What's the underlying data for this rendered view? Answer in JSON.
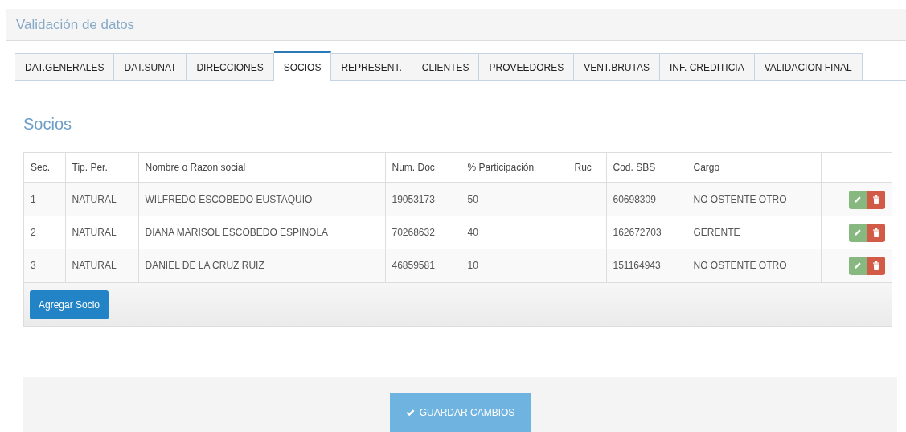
{
  "panel": {
    "title": "Validación de datos"
  },
  "tabs": [
    {
      "label": "DAT.GENERALES",
      "selected": false
    },
    {
      "label": "DAT.SUNAT",
      "selected": false
    },
    {
      "label": "DIRECCIONES",
      "selected": false
    },
    {
      "label": "SOCIOS",
      "selected": true
    },
    {
      "label": "REPRESENT.",
      "selected": false
    },
    {
      "label": "CLIENTES",
      "selected": false
    },
    {
      "label": "PROVEEDORES",
      "selected": false
    },
    {
      "label": "VENT.BRUTAS",
      "selected": false
    },
    {
      "label": "INF. CREDITICIA",
      "selected": false
    },
    {
      "label": "VALIDACION FINAL",
      "selected": false
    }
  ],
  "section": {
    "title": "Socios"
  },
  "table": {
    "columns": [
      "Sec.",
      "Tip. Per.",
      "Nombre o Razon social",
      "Num. Doc",
      "% Participación",
      "Ruc",
      "Cod. SBS",
      "Cargo"
    ],
    "rows": [
      [
        "1",
        "NATURAL",
        "WILFREDO ESCOBEDO EUSTAQUIO",
        "19053173",
        "50",
        "",
        "60698309",
        "NO OSTENTE OTRO"
      ],
      [
        "2",
        "NATURAL",
        "DIANA MARISOL ESCOBEDO ESPINOLA",
        "70268632",
        "40",
        "",
        "162672703",
        "GERENTE"
      ],
      [
        "3",
        "NATURAL",
        "DANIEL DE LA CRUZ RUIZ",
        "46859581",
        "10",
        "",
        "151164943",
        "NO OSTENTE OTRO"
      ]
    ]
  },
  "add_button": "Agregar Socio",
  "save_button": "GUARDAR CAMBIOS"
}
